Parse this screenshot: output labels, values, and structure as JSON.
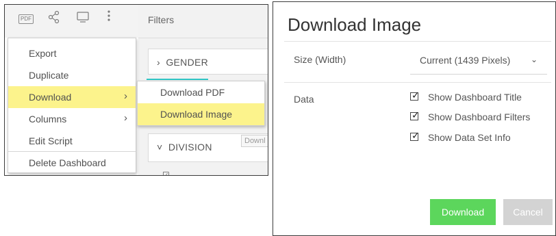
{
  "toolbar": {
    "pdf_icon_text": "PDF",
    "icons": [
      "pdf-icon",
      "share-icon",
      "monitor-icon",
      "more-vertical-icon"
    ]
  },
  "filters": {
    "title": "Filters",
    "gender_label": "GENDER",
    "division_label": "DIVISION",
    "tooltip": "Downl"
  },
  "menu": {
    "items": [
      {
        "label": "Export"
      },
      {
        "label": "Duplicate"
      },
      {
        "label": "Download"
      },
      {
        "label": "Columns"
      },
      {
        "label": "Edit Script"
      },
      {
        "label": "Delete Dashboard"
      }
    ],
    "submenu": [
      {
        "label": "Download PDF"
      },
      {
        "label": "Download Image"
      }
    ],
    "highlight_color": "#fcf38c"
  },
  "dialog": {
    "title": "Download Image",
    "size_label": "Size (Width)",
    "size_value": "Current (1439 Pixels)",
    "data_label": "Data",
    "options": [
      {
        "label": "Show Dashboard Title",
        "checked": true
      },
      {
        "label": "Show Dashboard Filters",
        "checked": true
      },
      {
        "label": "Show Data Set Info",
        "checked": true
      }
    ],
    "download_label": "Download",
    "cancel_label": "Cancel",
    "download_color": "#5cd65c",
    "cancel_color": "#d3d3d3"
  }
}
